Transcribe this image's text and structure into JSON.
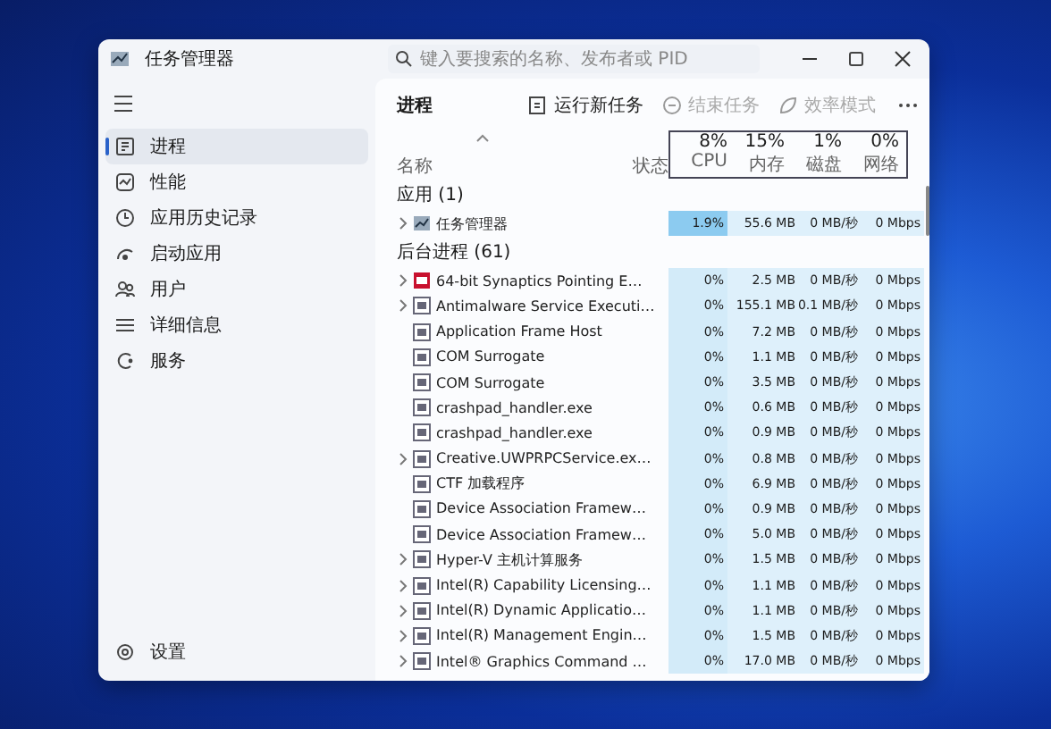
{
  "window": {
    "title": "任务管理器",
    "search": {
      "placeholder": "键入要搜索的名称、发布者或 PID"
    }
  },
  "sidebar": {
    "items": [
      {
        "label": "进程",
        "kind": "processes",
        "selected": true
      },
      {
        "label": "性能",
        "kind": "performance",
        "selected": false
      },
      {
        "label": "应用历史记录",
        "kind": "history",
        "selected": false
      },
      {
        "label": "启动应用",
        "kind": "startup",
        "selected": false
      },
      {
        "label": "用户",
        "kind": "users",
        "selected": false
      },
      {
        "label": "详细信息",
        "kind": "details",
        "selected": false
      },
      {
        "label": "服务",
        "kind": "services",
        "selected": false
      }
    ],
    "footer": {
      "label": "设置",
      "kind": "settings"
    }
  },
  "page": {
    "title": "进程",
    "toolbar": [
      {
        "label": "运行新任务",
        "kind": "run",
        "disabled": false
      },
      {
        "label": "结束任务",
        "kind": "end",
        "disabled": true
      },
      {
        "label": "效率模式",
        "kind": "efficiency",
        "disabled": true
      }
    ],
    "columns": {
      "name": "名称",
      "status": "状态",
      "metrics_highlighted": true,
      "metrics": [
        {
          "usage": "8%",
          "label": "CPU"
        },
        {
          "usage": "15%",
          "label": "内存"
        },
        {
          "usage": "1%",
          "label": "磁盘"
        },
        {
          "usage": "0%",
          "label": "网络"
        }
      ]
    },
    "groups": [
      {
        "title": "应用 (1)",
        "rows": [
          {
            "name": "任务管理器",
            "kind": "taskmgr",
            "expandable": true,
            "highlighted": true,
            "cpu": "1.9%",
            "memory": "55.6 MB",
            "disk": "0 MB/秒",
            "network": "0 Mbps"
          }
        ]
      },
      {
        "title": "后台进程 (61)",
        "rows": [
          {
            "name": "64-bit Synaptics Pointing E…",
            "kind": "red",
            "expandable": true,
            "highlighted": false,
            "cpu": "0%",
            "memory": "2.5 MB",
            "disk": "0 MB/秒",
            "network": "0 Mbps"
          },
          {
            "name": "Antimalware Service Executi…",
            "kind": "window",
            "expandable": true,
            "highlighted": false,
            "cpu": "0%",
            "memory": "155.1 MB",
            "disk": "0.1 MB/秒",
            "network": "0 Mbps"
          },
          {
            "name": "Application Frame Host",
            "kind": "window",
            "expandable": false,
            "highlighted": false,
            "cpu": "0%",
            "memory": "7.2 MB",
            "disk": "0 MB/秒",
            "network": "0 Mbps"
          },
          {
            "name": "COM Surrogate",
            "kind": "window",
            "expandable": false,
            "highlighted": false,
            "cpu": "0%",
            "memory": "1.1 MB",
            "disk": "0 MB/秒",
            "network": "0 Mbps"
          },
          {
            "name": "COM Surrogate",
            "kind": "window",
            "expandable": false,
            "highlighted": false,
            "cpu": "0%",
            "memory": "3.5 MB",
            "disk": "0 MB/秒",
            "network": "0 Mbps"
          },
          {
            "name": "crashpad_handler.exe",
            "kind": "window",
            "expandable": false,
            "highlighted": false,
            "cpu": "0%",
            "memory": "0.6 MB",
            "disk": "0 MB/秒",
            "network": "0 Mbps"
          },
          {
            "name": "crashpad_handler.exe",
            "kind": "window",
            "expandable": false,
            "highlighted": false,
            "cpu": "0%",
            "memory": "0.9 MB",
            "disk": "0 MB/秒",
            "network": "0 Mbps"
          },
          {
            "name": "Creative.UWPRPCService.ex…",
            "kind": "window",
            "expandable": true,
            "highlighted": false,
            "cpu": "0%",
            "memory": "0.8 MB",
            "disk": "0 MB/秒",
            "network": "0 Mbps"
          },
          {
            "name": "CTF 加载程序",
            "kind": "window",
            "expandable": false,
            "highlighted": false,
            "cpu": "0%",
            "memory": "6.9 MB",
            "disk": "0 MB/秒",
            "network": "0 Mbps"
          },
          {
            "name": "Device Association Framew…",
            "kind": "window",
            "expandable": false,
            "highlighted": false,
            "cpu": "0%",
            "memory": "0.9 MB",
            "disk": "0 MB/秒",
            "network": "0 Mbps"
          },
          {
            "name": "Device Association Framew…",
            "kind": "window",
            "expandable": false,
            "highlighted": false,
            "cpu": "0%",
            "memory": "5.0 MB",
            "disk": "0 MB/秒",
            "network": "0 Mbps"
          },
          {
            "name": "Hyper-V 主机计算服务",
            "kind": "window",
            "expandable": true,
            "highlighted": false,
            "cpu": "0%",
            "memory": "1.5 MB",
            "disk": "0 MB/秒",
            "network": "0 Mbps"
          },
          {
            "name": "Intel(R) Capability Licensing…",
            "kind": "window",
            "expandable": true,
            "highlighted": false,
            "cpu": "0%",
            "memory": "1.1 MB",
            "disk": "0 MB/秒",
            "network": "0 Mbps"
          },
          {
            "name": "Intel(R) Dynamic Applicatio…",
            "kind": "window",
            "expandable": true,
            "highlighted": false,
            "cpu": "0%",
            "memory": "1.1 MB",
            "disk": "0 MB/秒",
            "network": "0 Mbps"
          },
          {
            "name": "Intel(R) Management Engin…",
            "kind": "window",
            "expandable": true,
            "highlighted": false,
            "cpu": "0%",
            "memory": "1.5 MB",
            "disk": "0 MB/秒",
            "network": "0 Mbps"
          },
          {
            "name": "Intel® Graphics Command …",
            "kind": "window",
            "expandable": true,
            "highlighted": false,
            "cpu": "0%",
            "memory": "17.0 MB",
            "disk": "0 MB/秒",
            "network": "0 Mbps"
          }
        ]
      }
    ]
  }
}
